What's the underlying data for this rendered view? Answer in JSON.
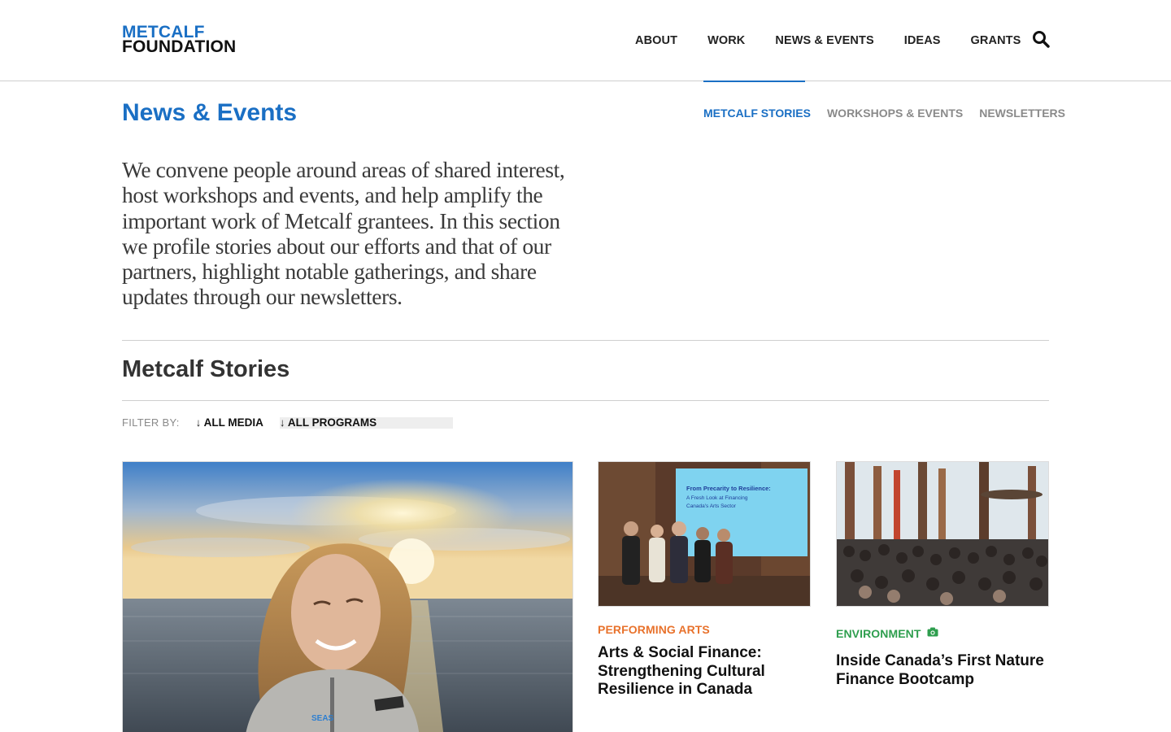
{
  "header": {
    "logo_line1": "METCALF",
    "logo_line2": "FOUNDATION",
    "nav": [
      "ABOUT",
      "WORK",
      "NEWS & EVENTS",
      "IDEAS",
      "GRANTS"
    ],
    "search_icon": "search-icon"
  },
  "page": {
    "title": "News & Events",
    "subnav": [
      "METCALF STORIES",
      "WORKSHOPS & EVENTS",
      "NEWSLETTERS"
    ],
    "intro": "We convene people around areas of shared interest, host workshops and events, and help amplify the important work of Metcalf grantees. In this section we profile stories about our efforts and that of our partners, highlight notable gatherings, and share updates through our newsletters."
  },
  "section": {
    "title": "Metcalf Stories",
    "filter_label": "FILTER BY:",
    "filter_media": "↓ ALL MEDIA",
    "filter_programs": "↓ ALL PROGRAMS"
  },
  "cards": [
    {
      "category": "PERFORMING ARTS",
      "title": "Arts & Social Finance: Strengthening Cultural Resilience in Canada",
      "slide_line1": "From Precarity to Resilience:",
      "slide_line2": "A Fresh Look at Financing",
      "slide_line3": "Canada's Arts Sector"
    },
    {
      "category": "ENVIRONMENT",
      "title": "Inside Canada’s First Nature Finance Bootcamp",
      "category_icon": "camera-icon"
    }
  ],
  "colors": {
    "brand_blue": "#1a6fc4",
    "arts_orange": "#e8722c",
    "env_green": "#2e9e4e"
  }
}
